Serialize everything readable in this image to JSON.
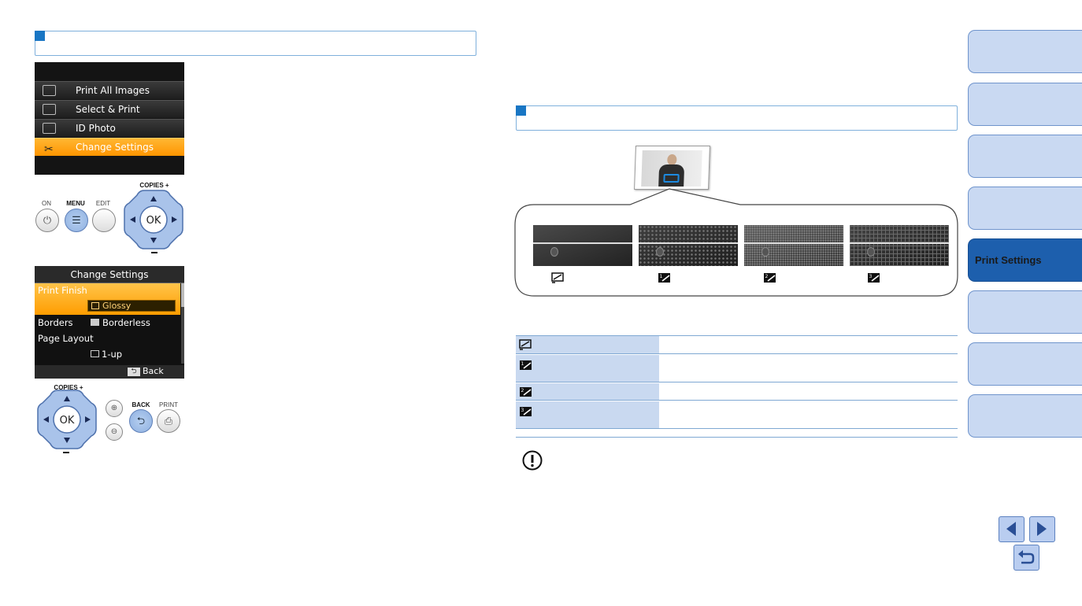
{
  "lcd_menu": {
    "items": [
      {
        "label": "Print All Images",
        "selected": false
      },
      {
        "label": "Select & Print",
        "selected": false
      },
      {
        "label": "ID Photo",
        "selected": false
      },
      {
        "label": "Change Settings",
        "selected": true
      }
    ]
  },
  "buttons_top": {
    "on": "ON",
    "menu": "MENU",
    "edit": "EDIT",
    "copies": "COPIES",
    "ok": "OK"
  },
  "lcd_settings": {
    "title": "Change Settings",
    "print_finish_label": "Print Finish",
    "print_finish_value": "Glossy",
    "borders_label": "Borders",
    "borders_value": "Borderless",
    "page_layout_label": "Page Layout",
    "page_layout_value": "1-up",
    "back": "Back"
  },
  "buttons_bottom": {
    "copies": "COPIES",
    "ok": "OK",
    "back": "BACK",
    "print": "PRINT"
  },
  "nav_tabs": [
    {
      "label": "",
      "active": false
    },
    {
      "label": "",
      "active": false
    },
    {
      "label": "",
      "active": false
    },
    {
      "label": "",
      "active": false
    },
    {
      "label": "Print Settings",
      "active": true
    },
    {
      "label": "",
      "active": false
    },
    {
      "label": "",
      "active": false
    },
    {
      "label": "",
      "active": false
    }
  ],
  "colors": {
    "accent": "#1976c4",
    "tab_fill": "#c9d9f2",
    "tab_active": "#1d5fad",
    "lcd_selected": "#ff9500"
  },
  "icons": [
    "finish-glossy-icon",
    "finish-pattern1-icon",
    "finish-pattern2-icon",
    "finish-pattern3-icon",
    "warning-icon",
    "prev-page-icon",
    "next-page-icon",
    "return-icon"
  ]
}
